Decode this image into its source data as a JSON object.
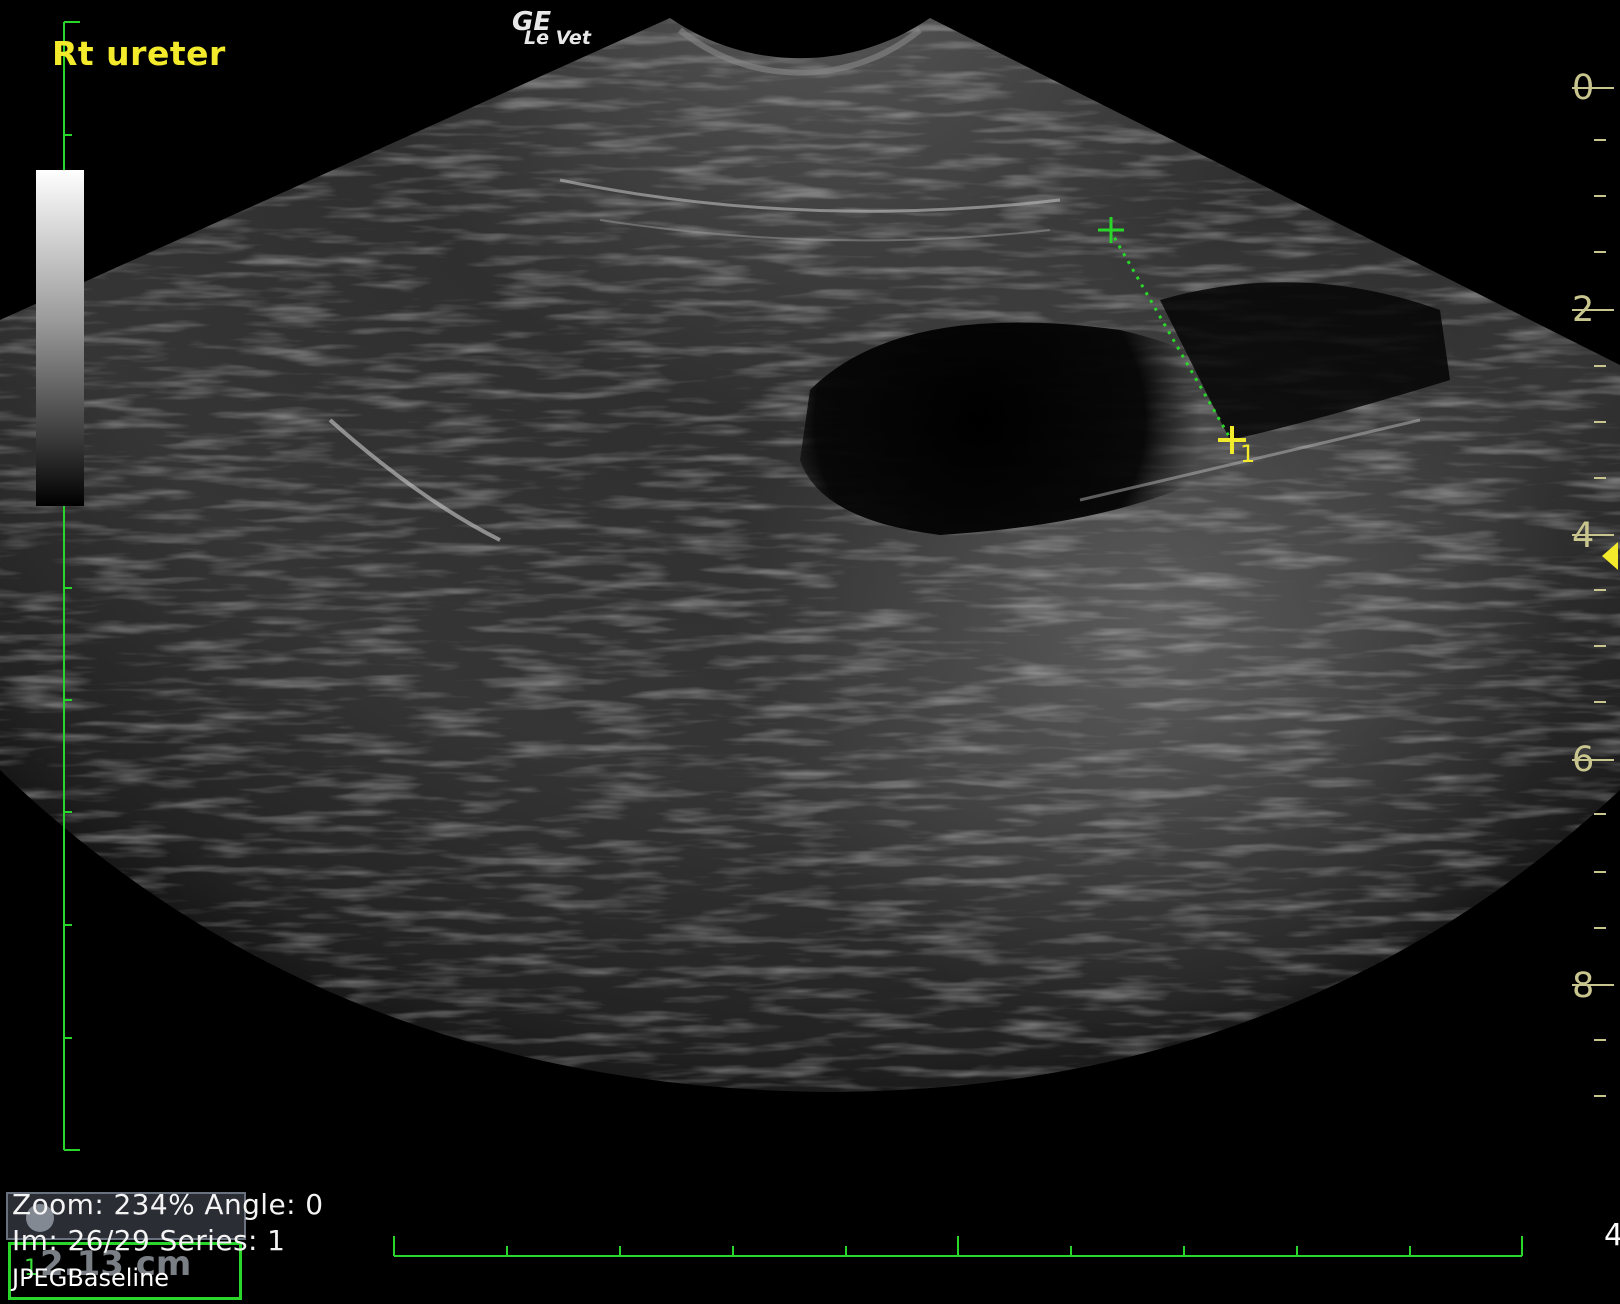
{
  "image": {
    "title": "Rt ureter",
    "logo": {
      "brand": "GE",
      "product": "Le Vet"
    },
    "depth_scale": {
      "labels": [
        "0",
        "2",
        "4",
        "6",
        "8"
      ],
      "unit": "cm"
    },
    "focus_marker_depth": 4,
    "measurement": {
      "index": "1",
      "value": "2.13 cm"
    },
    "status": {
      "zoom": "Zoom: 234% Angle: 0",
      "image": "Im: 26/29  Series:  1",
      "format": "JPEGBaseline"
    },
    "edge_label": "4",
    "colors": {
      "title": "#f2ea2a",
      "depth_labels": "#c9c58f",
      "ruler": "#2bd62b",
      "caliper_start": "#2bd62b",
      "caliper_end": "#f2ea2a"
    }
  }
}
